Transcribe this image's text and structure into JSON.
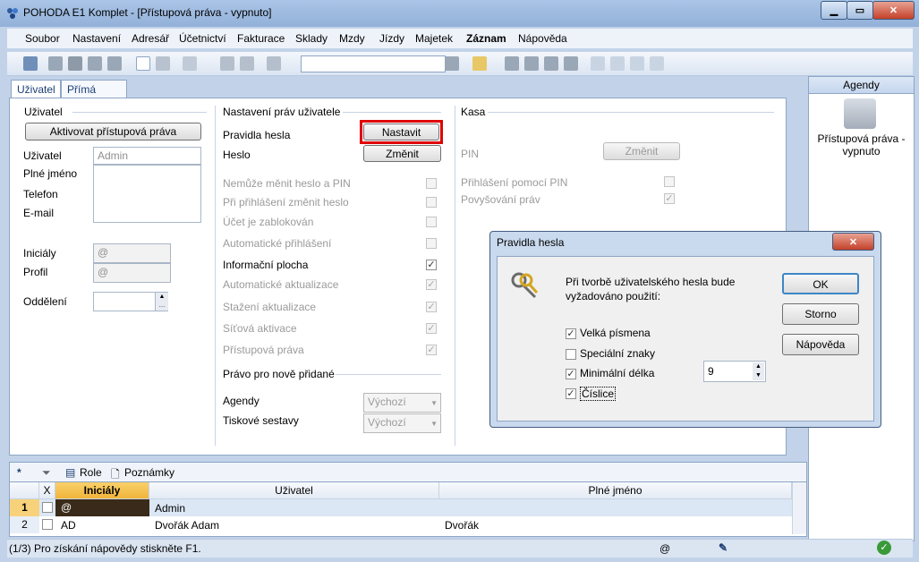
{
  "window": {
    "title": "POHODA E1 Komplet - [Přístupová práva - vypnuto]",
    "controls": {
      "minimize": "▁",
      "restore": "▭",
      "close": "✕"
    }
  },
  "menu": [
    "Soubor",
    "Nastavení",
    "Adresář",
    "Účetnictví",
    "Fakturace",
    "Sklady",
    "Mzdy",
    "Jízdy",
    "Majetek",
    "Záznam",
    "Nápověda"
  ],
  "tabs": [
    "Uživatel",
    "Přímá práva"
  ],
  "uzivatel": {
    "group_title": "Uživatel",
    "activate_button": "Aktivovat přístupová práva",
    "fields": {
      "uzivatel_label": "Uživatel",
      "uzivatel_value": "Admin",
      "plne_jmeno_label": "Plné jméno",
      "telefon_label": "Telefon",
      "email_label": "E-mail",
      "inicialy_label": "Iniciály",
      "inicialy_value": "@",
      "profil_label": "Profil",
      "profil_value": "@",
      "oddeleni_label": "Oddělení"
    }
  },
  "nastaveni": {
    "group_title": "Nastavení práv uživatele",
    "pravidla_label": "Pravidla hesla",
    "nastavit_button": "Nastavit",
    "heslo_label": "Heslo",
    "zmenit_button": "Změnit",
    "checks": [
      {
        "label": "Nemůže měnit heslo a PIN",
        "checked": false,
        "enabled": false
      },
      {
        "label": "Při přihlášení změnit heslo",
        "checked": false,
        "enabled": false
      },
      {
        "label": "Účet je zablokován",
        "checked": false,
        "enabled": false
      },
      {
        "label": "Automatické přihlášení",
        "checked": false,
        "enabled": false
      },
      {
        "label": "Informační plocha",
        "checked": true,
        "enabled": true
      },
      {
        "label": "Automatické aktualizace",
        "checked": true,
        "enabled": false
      },
      {
        "label": "Stažení aktualizace",
        "checked": true,
        "enabled": false
      },
      {
        "label": "Síťová aktivace",
        "checked": true,
        "enabled": false
      },
      {
        "label": "Přístupová práva",
        "checked": true,
        "enabled": false
      }
    ],
    "nove_title": "Právo pro nově přidané",
    "agendy_label": "Agendy",
    "agendy_value": "Výchozí",
    "tiskove_label": "Tiskové sestavy",
    "tiskove_value": "Výchozí"
  },
  "kasa": {
    "group_title": "Kasa",
    "pin_label": "PIN",
    "zmenit_button": "Změnit",
    "prihlaseni_pin": "Přihlášení pomocí PIN",
    "povysovani": "Povyšování práv"
  },
  "right_panel": {
    "header": "Agendy",
    "item_label": "Přístupová práva - vypnuto"
  },
  "bottom_tabs": {
    "star": "*",
    "role": "Role",
    "poznamky": "Poznámky"
  },
  "grid": {
    "columns": [
      "X",
      "Iniciály",
      "Uživatel",
      "Plné jméno"
    ],
    "rows": [
      {
        "num": "1",
        "inicialy": "@",
        "uzivatel": "Admin",
        "plne_jmeno": ""
      },
      {
        "num": "2",
        "inicialy": "AD",
        "uzivatel": "Dvořák Adam",
        "plne_jmeno": "Dvořák"
      }
    ]
  },
  "status": {
    "text": "(1/3) Pro získání nápovědy stiskněte F1.",
    "at": "@"
  },
  "dialog": {
    "title": "Pravidla hesla",
    "close": "✕",
    "message": "Při tvorbě uživatelského hesla bude vyžadováno použití:",
    "options": [
      {
        "label": "Velká písmena",
        "checked": true
      },
      {
        "label": "Speciální znaky",
        "checked": false
      },
      {
        "label": "Minimální délka",
        "checked": true
      },
      {
        "label": "Číslice",
        "checked": true
      }
    ],
    "min_length_value": "9",
    "ok": "OK",
    "storno": "Storno",
    "napoveda": "Nápověda"
  }
}
